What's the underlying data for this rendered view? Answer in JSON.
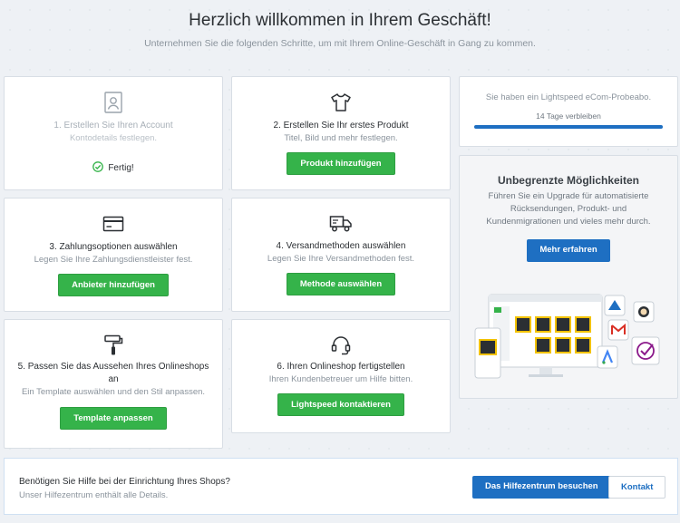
{
  "header": {
    "title": "Herzlich willkommen in Ihrem Geschäft!",
    "subtitle": "Unternehmen Sie die folgenden Schritte, um mit Ihrem Online-Geschäft in Gang zu kommen."
  },
  "steps": [
    {
      "title": "1. Erstellen Sie Ihren Account",
      "desc": "Kontodetails festlegen.",
      "status": "Fertig!",
      "icon": "account-icon"
    },
    {
      "title": "2. Erstellen Sie Ihr erstes Produkt",
      "desc": "Titel, Bild und mehr festlegen.",
      "button": "Produkt hinzufügen",
      "icon": "tshirt-icon"
    },
    {
      "title": "3. Zahlungsoptionen auswählen",
      "desc": "Legen Sie Ihre Zahlungsdienstleister fest.",
      "button": "Anbieter hinzufügen",
      "icon": "credit-card-icon"
    },
    {
      "title": "4. Versandmethoden auswählen",
      "desc": "Legen Sie Ihre Versandmethoden fest.",
      "button": "Methode auswählen",
      "icon": "truck-icon"
    },
    {
      "title": "5. Passen Sie das Aussehen Ihres Onlineshops",
      "title2": "an",
      "desc": "Ein Template auswählen und den Stil anpassen.",
      "button": "Template anpassen",
      "icon": "paint-roller-icon"
    },
    {
      "title": "6. Ihren Onlineshop fertigstellen",
      "desc": "Ihren Kundenbetreuer um Hilfe bitten.",
      "button": "Lightspeed kontaktieren",
      "icon": "headset-icon"
    }
  ],
  "trial": {
    "text": "Sie haben ein Lightspeed eCom-Probeabo.",
    "days": "14 Tage verbleiben",
    "progress_fraction": 1.0,
    "accent": "#1e6fc2"
  },
  "upgrade": {
    "title": "Unbegrenzte Möglichkeiten",
    "desc": "Führen Sie ein Upgrade für automatisierte Rücksendungen, Produkt- und Kundenmigrationen und vieles mehr durch.",
    "button": "Mehr erfahren"
  },
  "footer": {
    "question": "Benötigen Sie Hilfe bei der Einrichtung Ihres Shops?",
    "sub": "Unser Hilfezentrum enthält alle Details.",
    "help_button": "Das Hilfezentrum besuchen",
    "contact_button": "Kontakt"
  },
  "colors": {
    "green": "#35b34a",
    "blue": "#1e6fc2",
    "check": "#35b34a"
  }
}
